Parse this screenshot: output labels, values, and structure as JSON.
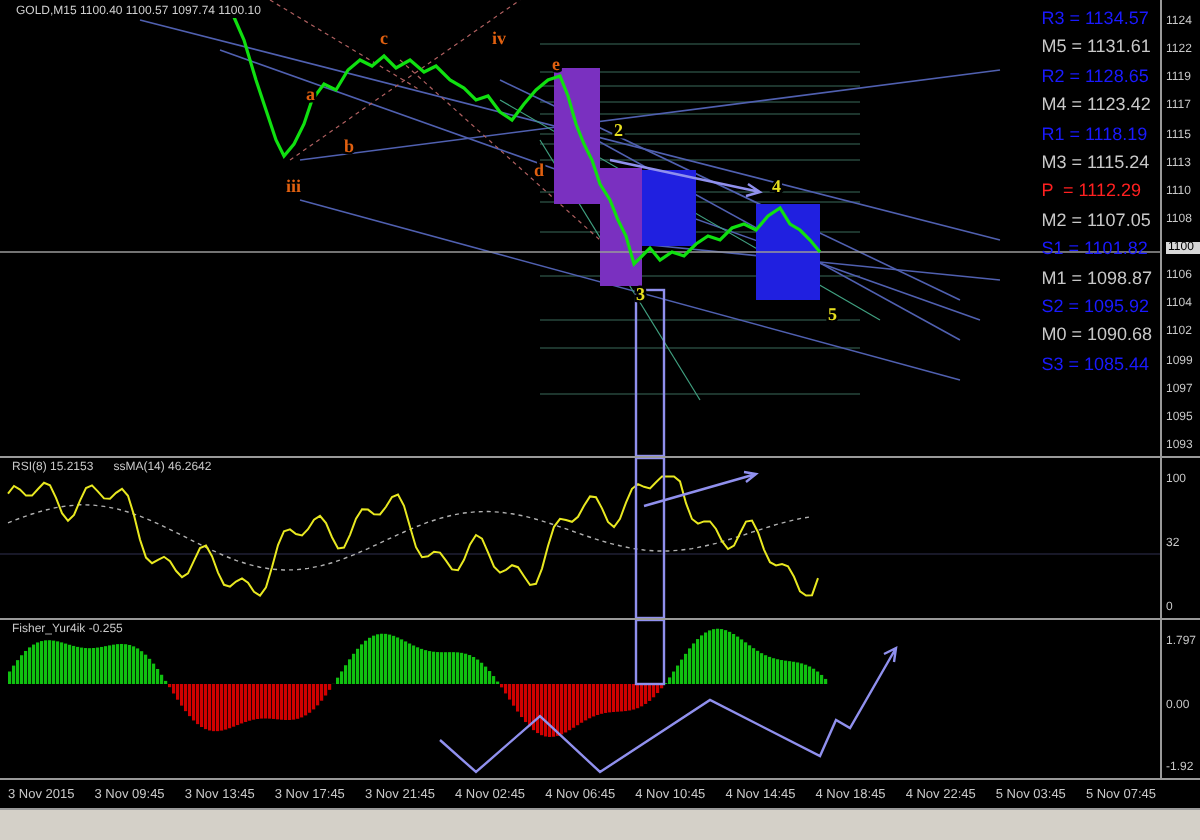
{
  "chart": {
    "header": "GOLD,M15  1100.40 1100.57 1097.74 1100.10",
    "price_axis": [
      "1124",
      "1122",
      "1119",
      "1117",
      "1115",
      "1113",
      "1110",
      "1108",
      "1106",
      "1104",
      "1102",
      "1099",
      "1097",
      "1095",
      "1093"
    ],
    "current_price": "1100",
    "pivot_levels": [
      {
        "label": "R3 = 1134.57",
        "kind": "resistance"
      },
      {
        "label": "M5 = 1131.61",
        "kind": "mid"
      },
      {
        "label": "R2 = 1128.65",
        "kind": "resistance"
      },
      {
        "label": "M4 = 1123.42",
        "kind": "mid"
      },
      {
        "label": "R1 = 1118.19",
        "kind": "resistance"
      },
      {
        "label": "M3 = 1115.24",
        "kind": "mid"
      },
      {
        "label": "P  = 1112.29",
        "kind": "pivot"
      },
      {
        "label": "M2 = 1107.05",
        "kind": "mid"
      },
      {
        "label": "S1 = 1101.82",
        "kind": "support"
      },
      {
        "label": "M1 = 1098.87",
        "kind": "mid"
      },
      {
        "label": "S2 = 1095.92",
        "kind": "support"
      },
      {
        "label": "M0 = 1090.68",
        "kind": "mid"
      },
      {
        "label": "S3 = 1085.44",
        "kind": "support"
      }
    ],
    "wave_labels": [
      {
        "text": "iii",
        "kind": "subwave"
      },
      {
        "text": "a",
        "kind": "subwave"
      },
      {
        "text": "b",
        "kind": "subwave"
      },
      {
        "text": "c",
        "kind": "subwave"
      },
      {
        "text": "iv",
        "kind": "subwave"
      },
      {
        "text": "e",
        "kind": "subwave"
      },
      {
        "text": "d",
        "kind": "subwave"
      },
      {
        "text": "2",
        "kind": "wave"
      },
      {
        "text": "3",
        "kind": "wave"
      },
      {
        "text": "4",
        "kind": "wave"
      },
      {
        "text": "5",
        "kind": "wave"
      }
    ]
  },
  "rsi": {
    "label": "RSI(8) 15.2153",
    "ma_label": "ssMA(14) 46.2642",
    "axis": [
      "100",
      "32",
      "0"
    ]
  },
  "fisher": {
    "label": "Fisher_Yur4ik -0.255",
    "axis": [
      "1.797",
      "0.00",
      "-1.92"
    ]
  },
  "time_axis": [
    "3 Nov 2015",
    "3 Nov 09:45",
    "3 Nov 13:45",
    "3 Nov 17:45",
    "3 Nov 21:45",
    "4 Nov 02:45",
    "4 Nov 06:45",
    "4 Nov 10:45",
    "4 Nov 14:45",
    "4 Nov 18:45",
    "4 Nov 22:45",
    "5 Nov 03:45",
    "5 Nov 07:45"
  ]
}
